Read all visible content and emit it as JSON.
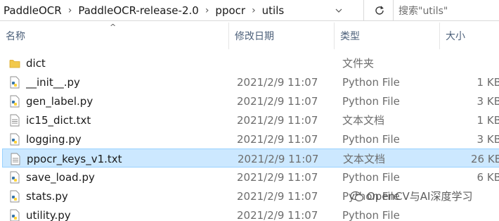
{
  "address": {
    "crumbs": [
      "PaddleOCR",
      "PaddleOCR-release-2.0",
      "ppocr",
      "utils"
    ],
    "separator": "›",
    "dropdown_icon": "chevron-down-icon",
    "refresh_icon": "refresh-icon"
  },
  "search": {
    "placeholder": "搜索\"utils\""
  },
  "columns": {
    "name": "名称",
    "date": "修改日期",
    "type": "类型",
    "size": "大小",
    "sort_indicator": "^"
  },
  "files": [
    {
      "name": "dict",
      "date": "",
      "type": "文件夹",
      "size": "",
      "icon": "folder-icon"
    },
    {
      "name": "__init__.py",
      "date": "2021/2/9 11:07",
      "type": "Python File",
      "size": "1 KB",
      "icon": "python-file-icon"
    },
    {
      "name": "gen_label.py",
      "date": "2021/2/9 11:07",
      "type": "Python File",
      "size": "3 KB",
      "icon": "python-file-icon"
    },
    {
      "name": "ic15_dict.txt",
      "date": "2021/2/9 11:07",
      "type": "文本文档",
      "size": "1 KB",
      "icon": "text-file-icon"
    },
    {
      "name": "logging.py",
      "date": "2021/2/9 11:07",
      "type": "Python File",
      "size": "3 KB",
      "icon": "python-file-icon"
    },
    {
      "name": "ppocr_keys_v1.txt",
      "date": "2021/2/9 11:07",
      "type": "文本文档",
      "size": "26 KB",
      "icon": "text-file-icon",
      "selected": true
    },
    {
      "name": "save_load.py",
      "date": "2021/2/9 11:07",
      "type": "Python File",
      "size": "6 KB",
      "icon": "python-file-icon"
    },
    {
      "name": "stats.py",
      "date": "2021/2/9 11:07",
      "type": "Python File",
      "size": "",
      "icon": "python-file-icon"
    },
    {
      "name": "utility.py",
      "date": "2021/2/9 11:07",
      "type": "Python File",
      "size": "",
      "icon": "python-file-icon"
    }
  ],
  "watermark": {
    "text": "OpenCV与AI深度学习",
    "icon": "wechat-icon"
  },
  "colors": {
    "selection_bg": "#cce8ff",
    "selection_border": "#99d1ff",
    "header_text": "#4c607a",
    "folder": "#f2c94c"
  }
}
